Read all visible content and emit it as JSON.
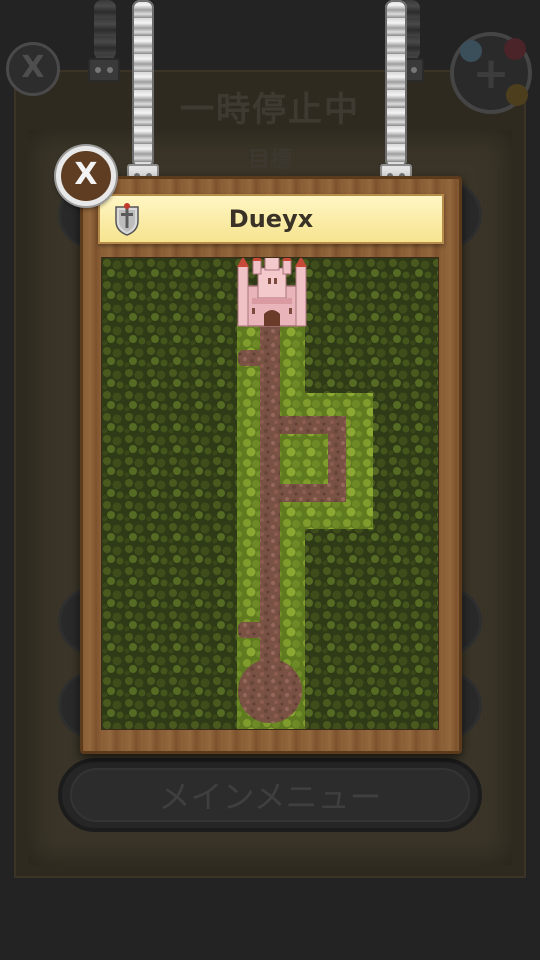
{
  "background": {
    "pause_title": "一時停止中",
    "goal_label": "目標",
    "main_menu_label": "メインメニュー",
    "close_glyph": "X",
    "plus_glyph": "+"
  },
  "popup": {
    "close_glyph": "X",
    "level_name": "Dueyx"
  },
  "colors": {
    "hedge_dark": "#39451a",
    "hedge_light": "#6e8a25",
    "path_dirt": "#7d5546",
    "castle_wall": "#e9b4ba",
    "castle_roof": "#c64a37",
    "wood": "#8a5e36",
    "banner": "#f6e48f"
  },
  "icons": [
    "close-icon",
    "plus-icon",
    "shield-sword-icon",
    "castle-icon"
  ]
}
